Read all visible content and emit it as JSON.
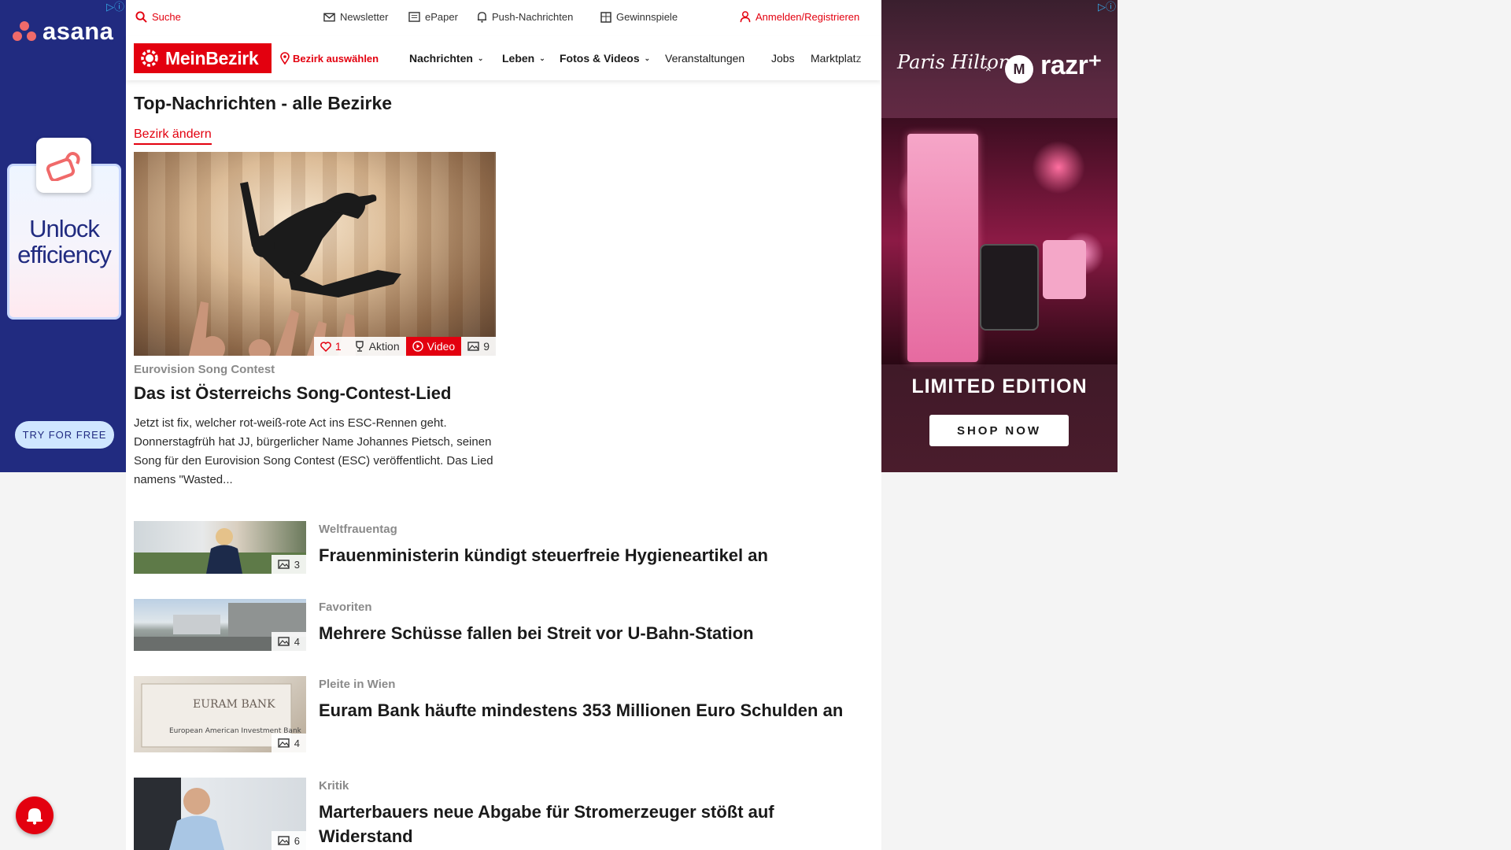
{
  "ad_left": {
    "adchoice": "▷ⓘ",
    "brand": "asana",
    "headline": "Unlock efficiency",
    "cta": "TRY FOR FREE"
  },
  "topbar": {
    "search": "Suche",
    "newsletter": "Newsletter",
    "epaper": "ePaper",
    "push": "Push-Nachrichten",
    "contests": "Gewinnspiele",
    "login": "Anmelden/Registrieren"
  },
  "nav": {
    "logo": "MeinBezirk",
    "district_select": "Bezirk auswählen",
    "items": [
      "Nachrichten",
      "Leben",
      "Fotos & Videos",
      "Veranstaltungen",
      "Jobs",
      "Marktplatz"
    ]
  },
  "page": {
    "title": "Top-Nachrichten - alle Bezirke",
    "change_district": "Bezirk ändern"
  },
  "featured": {
    "likes": "1",
    "action": "Aktion",
    "video": "Video",
    "photos": "9",
    "kicker": "Eurovision Song Contest",
    "title": "Das ist Österreichs Song-Contest-Lied",
    "teaser": "Jetzt ist fix, welcher rot-weiß-rote Act ins ESC-Rennen geht. Donnerstagfrüh hat JJ, bürgerlicher Name Johannes Pietsch, seinen Song für den Eurovision Song Contest (ESC) veröffentlicht. Das Lied namens \"Wasted..."
  },
  "articles": [
    {
      "kicker": "Weltfrauentag",
      "title": "Frauenministerin kündigt steuerfreie Hygieneartikel an",
      "photos": "3"
    },
    {
      "kicker": "Favoriten",
      "title": "Mehrere Schüsse fallen bei Streit vor U-Bahn-Station",
      "photos": "4"
    },
    {
      "kicker": "Pleite in Wien",
      "title": "Euram Bank häufte mindestens 353 Millionen Euro Schulden an",
      "photos": "4"
    },
    {
      "kicker": "Kritik",
      "title": "Marterbauers neue Abgabe für Stromerzeuger stößt auf Widerstand",
      "photos": "6"
    }
  ],
  "ad_right": {
    "adchoice": "▷ⓘ",
    "signature": "Paris Hilton",
    "times": "×",
    "moto": "M",
    "brand": "razr⁺",
    "headline": "LIMITED EDITION",
    "cta": "SHOP NOW"
  },
  "colors": {
    "brand_red": "#e3000f",
    "asana_navy": "#212b80"
  }
}
